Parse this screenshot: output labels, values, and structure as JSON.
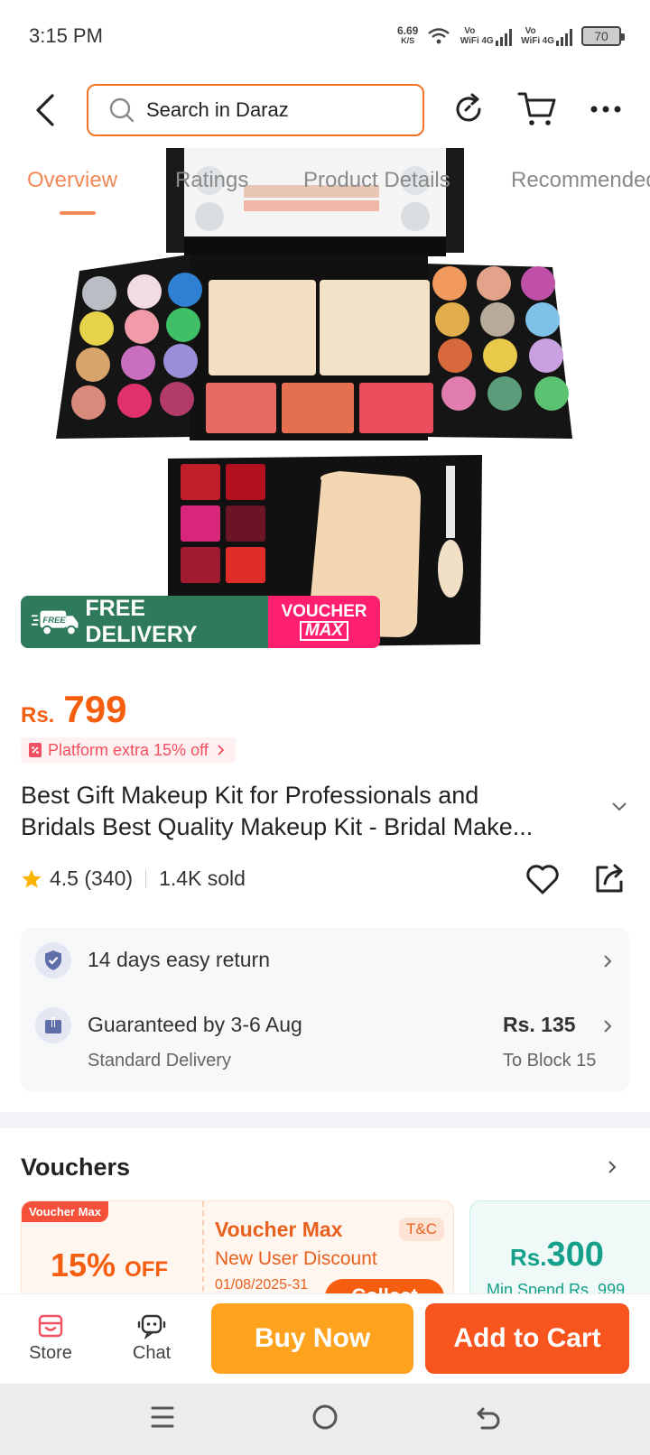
{
  "status_bar": {
    "time": "3:15 PM",
    "speed_value": "6.69",
    "speed_unit": "K/S",
    "sim1_label": "Vo WiFi",
    "sim1_net": "4G",
    "sim2_label": "Vo WiFi",
    "sim2_net": "4G",
    "battery": "70"
  },
  "header": {
    "search_placeholder": "Search in Daraz",
    "icons": [
      "back-icon",
      "refresh-icon",
      "cart-icon",
      "more-icon"
    ]
  },
  "tabs": [
    {
      "label": "Overview",
      "active": true
    },
    {
      "label": "Ratings",
      "active": false
    },
    {
      "label": "Product Details",
      "active": false
    },
    {
      "label": "Recommended",
      "active": false
    }
  ],
  "promo": {
    "free_badge": "FREE",
    "free_delivery": "FREE DELIVERY",
    "voucher_line1": "VOUCHER",
    "voucher_line2": "MAX"
  },
  "product": {
    "currency": "Rs.",
    "price": "799",
    "platform_badge": "Platform extra 15% off",
    "title_line1": "Best Gift Makeup Kit for Professionals and",
    "title_line2": "Bridals Best Quality Makeup Kit - Bridal Make...",
    "rating": "4.5 (340)",
    "sold": "1.4K sold"
  },
  "info": {
    "return_text": "14 days easy return",
    "delivery_main": "Guaranteed by 3-6 Aug",
    "delivery_sub": "Standard Delivery",
    "delivery_price": "Rs. 135",
    "delivery_location": "To Block 15"
  },
  "vouchers": {
    "title": "Vouchers",
    "card1": {
      "tag": "Voucher Max",
      "percent": "15%",
      "off": "OFF",
      "name": "Voucher Max",
      "description": "New User Discount",
      "date": "01/08/2025-31",
      "tc": "T&C",
      "collect": "Collect"
    },
    "card2": {
      "currency": "Rs.",
      "amount": "300",
      "min_spend": "Min.Spend Rs. 999"
    }
  },
  "bottom_bar": {
    "store": "Store",
    "chat": "Chat",
    "buy_now": "Buy Now",
    "add_to_cart": "Add to Cart"
  },
  "colors": {
    "accent": "#f57224",
    "price": "#f55e0f",
    "buy_now": "#ffa31f",
    "add_to_cart": "#f7541e",
    "free_delivery": "#2f7a5a",
    "voucher_max": "#ff1f6e"
  }
}
